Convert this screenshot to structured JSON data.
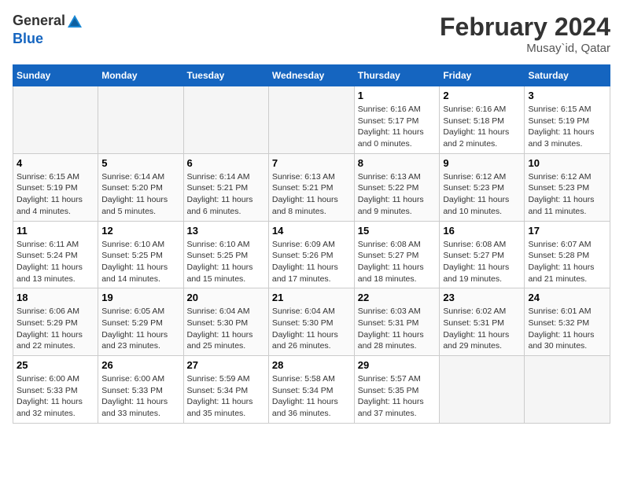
{
  "logo": {
    "general": "General",
    "blue": "Blue"
  },
  "title": {
    "month": "February 2024",
    "location": "Musay`id, Qatar"
  },
  "weekdays": [
    "Sunday",
    "Monday",
    "Tuesday",
    "Wednesday",
    "Thursday",
    "Friday",
    "Saturday"
  ],
  "weeks": [
    [
      {
        "day": "",
        "empty": true
      },
      {
        "day": "",
        "empty": true
      },
      {
        "day": "",
        "empty": true
      },
      {
        "day": "",
        "empty": true
      },
      {
        "day": "1",
        "sunrise": "6:16 AM",
        "sunset": "5:17 PM",
        "daylight": "11 hours and 0 minutes."
      },
      {
        "day": "2",
        "sunrise": "6:16 AM",
        "sunset": "5:18 PM",
        "daylight": "11 hours and 2 minutes."
      },
      {
        "day": "3",
        "sunrise": "6:15 AM",
        "sunset": "5:19 PM",
        "daylight": "11 hours and 3 minutes."
      }
    ],
    [
      {
        "day": "4",
        "sunrise": "6:15 AM",
        "sunset": "5:19 PM",
        "daylight": "11 hours and 4 minutes."
      },
      {
        "day": "5",
        "sunrise": "6:14 AM",
        "sunset": "5:20 PM",
        "daylight": "11 hours and 5 minutes."
      },
      {
        "day": "6",
        "sunrise": "6:14 AM",
        "sunset": "5:21 PM",
        "daylight": "11 hours and 6 minutes."
      },
      {
        "day": "7",
        "sunrise": "6:13 AM",
        "sunset": "5:21 PM",
        "daylight": "11 hours and 8 minutes."
      },
      {
        "day": "8",
        "sunrise": "6:13 AM",
        "sunset": "5:22 PM",
        "daylight": "11 hours and 9 minutes."
      },
      {
        "day": "9",
        "sunrise": "6:12 AM",
        "sunset": "5:23 PM",
        "daylight": "11 hours and 10 minutes."
      },
      {
        "day": "10",
        "sunrise": "6:12 AM",
        "sunset": "5:23 PM",
        "daylight": "11 hours and 11 minutes."
      }
    ],
    [
      {
        "day": "11",
        "sunrise": "6:11 AM",
        "sunset": "5:24 PM",
        "daylight": "11 hours and 13 minutes."
      },
      {
        "day": "12",
        "sunrise": "6:10 AM",
        "sunset": "5:25 PM",
        "daylight": "11 hours and 14 minutes."
      },
      {
        "day": "13",
        "sunrise": "6:10 AM",
        "sunset": "5:25 PM",
        "daylight": "11 hours and 15 minutes."
      },
      {
        "day": "14",
        "sunrise": "6:09 AM",
        "sunset": "5:26 PM",
        "daylight": "11 hours and 17 minutes."
      },
      {
        "day": "15",
        "sunrise": "6:08 AM",
        "sunset": "5:27 PM",
        "daylight": "11 hours and 18 minutes."
      },
      {
        "day": "16",
        "sunrise": "6:08 AM",
        "sunset": "5:27 PM",
        "daylight": "11 hours and 19 minutes."
      },
      {
        "day": "17",
        "sunrise": "6:07 AM",
        "sunset": "5:28 PM",
        "daylight": "11 hours and 21 minutes."
      }
    ],
    [
      {
        "day": "18",
        "sunrise": "6:06 AM",
        "sunset": "5:29 PM",
        "daylight": "11 hours and 22 minutes."
      },
      {
        "day": "19",
        "sunrise": "6:05 AM",
        "sunset": "5:29 PM",
        "daylight": "11 hours and 23 minutes."
      },
      {
        "day": "20",
        "sunrise": "6:04 AM",
        "sunset": "5:30 PM",
        "daylight": "11 hours and 25 minutes."
      },
      {
        "day": "21",
        "sunrise": "6:04 AM",
        "sunset": "5:30 PM",
        "daylight": "11 hours and 26 minutes."
      },
      {
        "day": "22",
        "sunrise": "6:03 AM",
        "sunset": "5:31 PM",
        "daylight": "11 hours and 28 minutes."
      },
      {
        "day": "23",
        "sunrise": "6:02 AM",
        "sunset": "5:31 PM",
        "daylight": "11 hours and 29 minutes."
      },
      {
        "day": "24",
        "sunrise": "6:01 AM",
        "sunset": "5:32 PM",
        "daylight": "11 hours and 30 minutes."
      }
    ],
    [
      {
        "day": "25",
        "sunrise": "6:00 AM",
        "sunset": "5:33 PM",
        "daylight": "11 hours and 32 minutes."
      },
      {
        "day": "26",
        "sunrise": "6:00 AM",
        "sunset": "5:33 PM",
        "daylight": "11 hours and 33 minutes."
      },
      {
        "day": "27",
        "sunrise": "5:59 AM",
        "sunset": "5:34 PM",
        "daylight": "11 hours and 35 minutes."
      },
      {
        "day": "28",
        "sunrise": "5:58 AM",
        "sunset": "5:34 PM",
        "daylight": "11 hours and 36 minutes."
      },
      {
        "day": "29",
        "sunrise": "5:57 AM",
        "sunset": "5:35 PM",
        "daylight": "11 hours and 37 minutes."
      },
      {
        "day": "",
        "empty": true
      },
      {
        "day": "",
        "empty": true
      }
    ]
  ]
}
